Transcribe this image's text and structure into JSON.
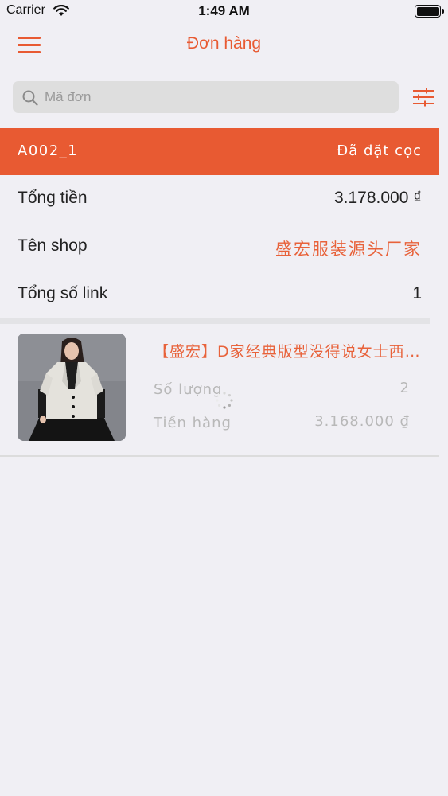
{
  "status_bar": {
    "carrier": "Carrier",
    "time": "1:49 AM"
  },
  "nav": {
    "title": "Đơn hàng",
    "menu_icon": "hamburger-menu-icon",
    "filter_icon": "filter-sliders-icon"
  },
  "search": {
    "placeholder": "Mã đơn",
    "value": ""
  },
  "order": {
    "code": "A002_1",
    "status": "Đã đặt cọc",
    "rows": [
      {
        "label": "Tổng tiền",
        "value": "3.178.000 ₫"
      },
      {
        "label": "Tên shop",
        "value": "盛宏服装源头厂家"
      },
      {
        "label": "Tổng số link",
        "value": "1"
      }
    ]
  },
  "product": {
    "title": "【盛宏】D家经典版型没得说女士西装外套",
    "quantity_label": "Số lượng",
    "quantity": "2",
    "amount_label": "Tiền hàng",
    "amount": "3.168.000 ₫"
  },
  "colors": {
    "accent": "#e85a32",
    "background": "#f0eff4",
    "muted_text": "#b8b8b8"
  }
}
